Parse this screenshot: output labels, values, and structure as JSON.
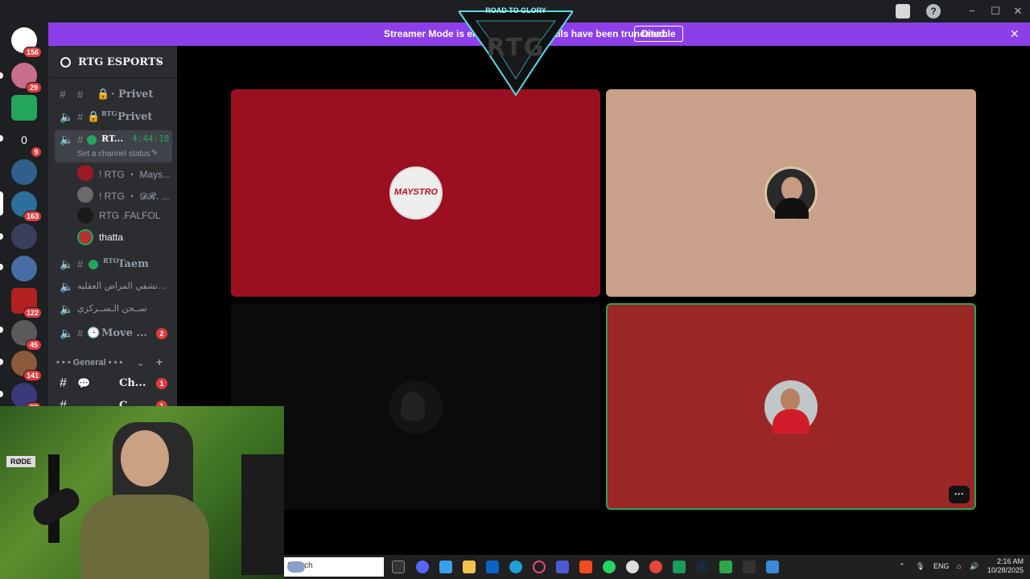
{
  "banner": {
    "message": "Streamer Mode is enabled. Some details have been truncated.",
    "disable_label": "Disable",
    "close_icon": "×"
  },
  "guilds": [
    {
      "badge": "156",
      "color": "#e8e8e8"
    },
    {
      "badge": "29",
      "color": "#c86f8c"
    },
    {
      "badge": "",
      "color": "#23a55a"
    },
    {
      "badge": "9",
      "color": "#1e1f22",
      "label": "0"
    },
    {
      "badge": "",
      "color": "#2f5f8c"
    },
    {
      "badge": "163",
      "color": "#2d6f9c"
    },
    {
      "badge": "",
      "color": "#3a3f5c"
    },
    {
      "badge": "",
      "color": "#4a6ca4"
    },
    {
      "badge": "122",
      "color": "#b32020"
    },
    {
      "badge": "45",
      "color": "#5a5a5a"
    },
    {
      "badge": "141",
      "color": "#8a5a3a"
    },
    {
      "badge": "87",
      "color": "#3a3a7a"
    }
  ],
  "server": {
    "name": "RTG ESPORTS"
  },
  "channels": [
    {
      "label": "· Privet",
      "icon": "#",
      "lock": true
    },
    {
      "label": "Privet",
      "prefix": "RTG",
      "icon": "speaker",
      "lock": true
    },
    {
      "label": "RT...",
      "icon": "speaker",
      "timer": "4:44:18",
      "status": "Set a channel status",
      "active": true
    },
    {
      "label": "Taem",
      "prefix": "RTG",
      "icon": "speaker",
      "dot": true
    },
    {
      "label": "تشفي المراض العقليه...",
      "icon": "speaker"
    },
    {
      "label": "ســجن الـســركزي",
      "icon": "speaker"
    },
    {
      "label": "Move ...",
      "icon": "speaker",
      "clock": true,
      "badge": "2"
    }
  ],
  "members": [
    {
      "name": "! RTG ・ Mays...",
      "color": "#9b1a26"
    },
    {
      "name": "! RTG ・ 𝓓𝓡. ...",
      "color": "#6a6a6a"
    },
    {
      "name": "RTG .FALFOL",
      "color": "#1a1a1a"
    },
    {
      "name": "thatta",
      "color": "#b73030"
    }
  ],
  "category": {
    "label": "• • • General • • •",
    "add": "+"
  },
  "text_channels": [
    {
      "label": "Ch...",
      "badge": "1"
    },
    {
      "label": "C...",
      "badge": "1"
    }
  ],
  "tiles": [
    {
      "bg": "#9b1020",
      "avatar_text": "MAYSTRO",
      "speaking": false
    },
    {
      "bg": "#c9a08a",
      "speaking": false
    },
    {
      "bg": "#0b0b0b",
      "speaking": false
    },
    {
      "bg": "#9b2626",
      "speaking": true
    }
  ],
  "logo": {
    "text": "RTG",
    "subtitle": "ROAD TO GLORY"
  },
  "taskbar": {
    "search_placeholder": "Search",
    "lang": "ENG",
    "time": "2:16 AM",
    "date": "10/28/2025"
  },
  "colors": {
    "accent": "#8c3fe8",
    "speaking": "#23a55a",
    "badge": "#e03c3c"
  }
}
